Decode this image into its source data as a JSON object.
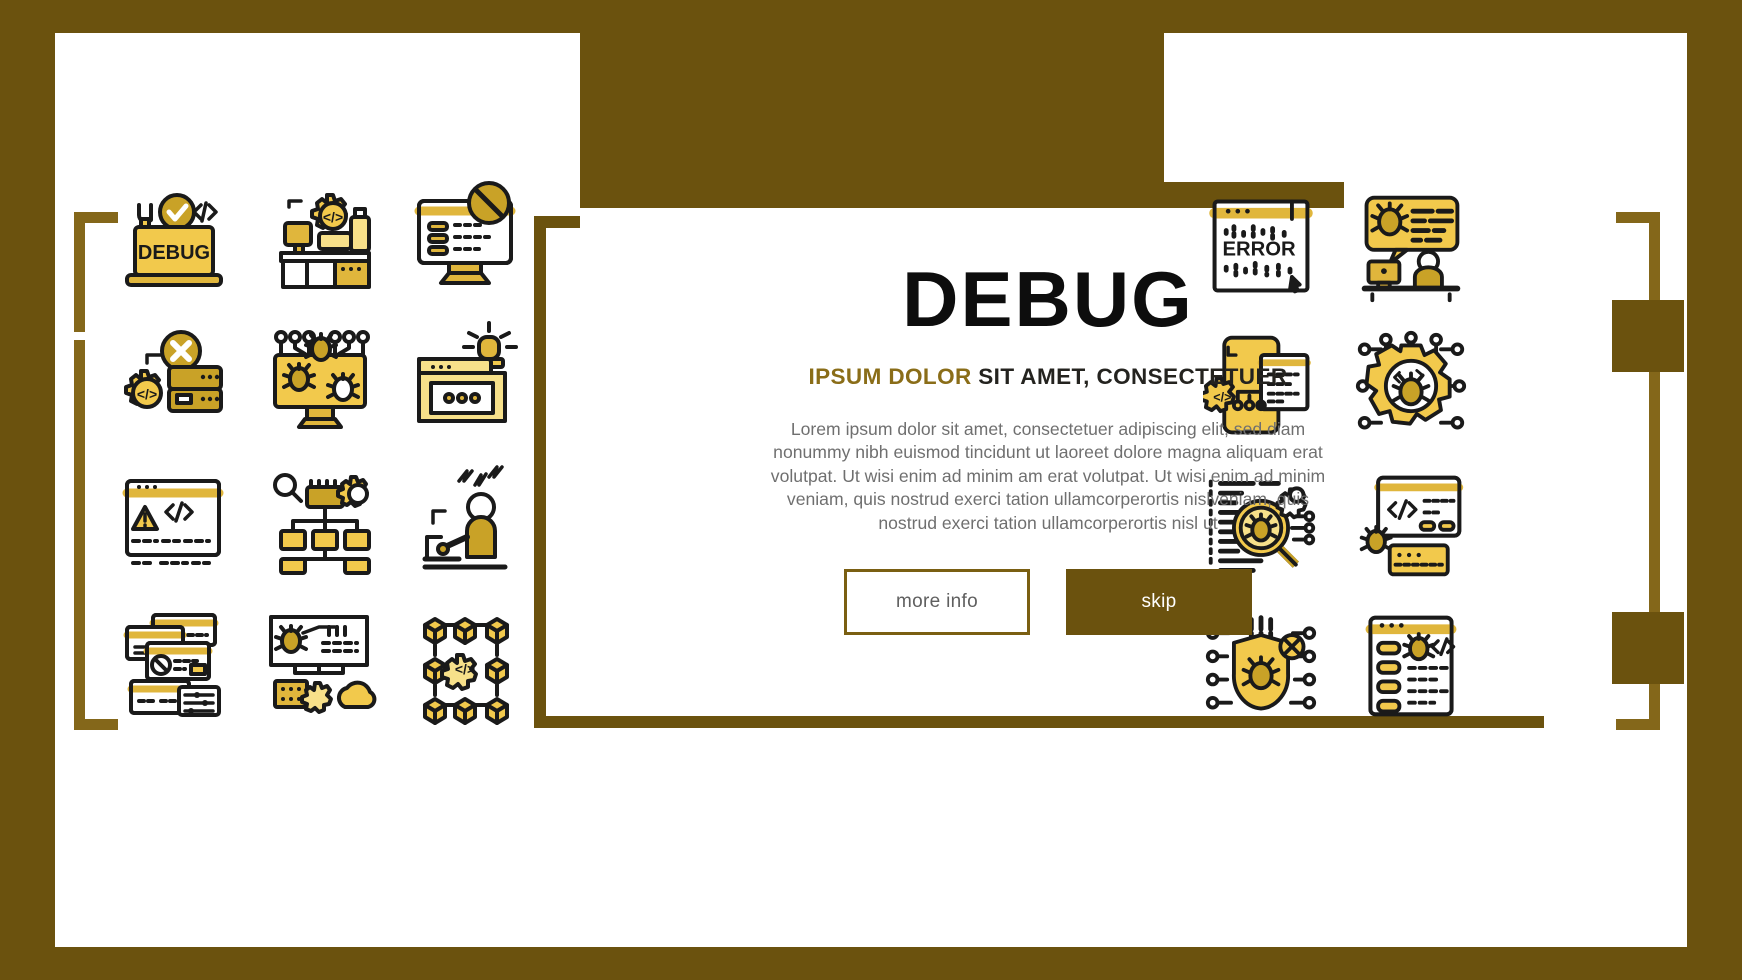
{
  "theme": {
    "frame_brown": "#6b520e",
    "accent_gold": "#8a6d18",
    "icon_yellow": "#f2c94c",
    "icon_yellow_light": "#f7e08a",
    "icon_dark_gold": "#c9a227",
    "outline": "#1a1a1a",
    "body_text": "#6f6f6f",
    "title_black": "#0d0d0d",
    "page_white": "#ffffff"
  },
  "hero": {
    "title": "DEBUG",
    "subtitle_accent": "IPSUM DOLOR",
    "subtitle_rest": " SIT AMET, CONSECTETUER",
    "body": "Lorem ipsum dolor sit amet, consectetuer adipiscing elit, sed diam nonummy nibh euismod tincidunt ut laoreet dolore magna aliquam erat volutpat. Ut wisi enim ad minim am erat volutpat. Ut wisi enim ad minim veniam, quis nostrud exerci tation ullamcorperortis nislveniam, quis nostrud exerci tation ullamcorperortis nisl ut"
  },
  "buttons": {
    "more_info": "more info",
    "skip": "skip"
  },
  "icon_labels": {
    "debug_screen": "DEBUG",
    "error_screen": "ERROR"
  },
  "left_icons": [
    {
      "id": "laptop-debug-icon",
      "label": "DEBUG"
    },
    {
      "id": "workstation-code-gear-icon",
      "label": ""
    },
    {
      "id": "monitor-blocked-code-icon",
      "label": ""
    },
    {
      "id": "server-error-gear-icon",
      "label": ""
    },
    {
      "id": "monitor-bugs-circuit-icon",
      "label": ""
    },
    {
      "id": "folder-alert-siren-icon",
      "label": ""
    },
    {
      "id": "browser-warning-code-icon",
      "label": ""
    },
    {
      "id": "flowchart-search-gear-icon",
      "label": ""
    },
    {
      "id": "developer-stress-icon",
      "label": ""
    },
    {
      "id": "windows-blocked-settings-icon",
      "label": ""
    },
    {
      "id": "bug-diagram-cloud-server-icon",
      "label": ""
    },
    {
      "id": "blockchain-code-nodes-icon",
      "label": ""
    }
  ],
  "right_icons": [
    {
      "id": "error-window-icon",
      "label": "ERROR"
    },
    {
      "id": "support-chat-bug-icon",
      "label": ""
    },
    {
      "id": "mobile-code-circuit-icon",
      "label": ""
    },
    {
      "id": "gear-bug-circuit-icon",
      "label": ""
    },
    {
      "id": "magnifier-bug-code-icon",
      "label": ""
    },
    {
      "id": "browser-bug-code-icon",
      "label": ""
    },
    {
      "id": "shield-bug-circuit-icon",
      "label": ""
    },
    {
      "id": "window-bug-list-icon",
      "label": ""
    }
  ]
}
